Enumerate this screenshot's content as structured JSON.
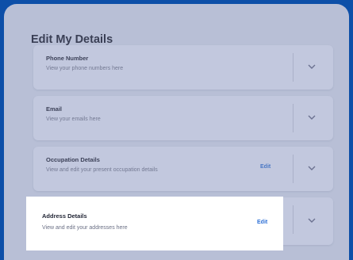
{
  "page": {
    "title": "Edit My Details"
  },
  "sections": [
    {
      "title": "Phone Number",
      "description": "View your phone numbers here",
      "action": ""
    },
    {
      "title": "Email",
      "description": "View your emails here",
      "action": ""
    },
    {
      "title": "Occupation Details",
      "description": "View and edit your present occupation details",
      "action": "Edit"
    },
    {
      "title": "Address Details",
      "description": "View and edit your addresses here",
      "action": "Edit"
    }
  ],
  "icons": {
    "expand": "chevron-down-icon"
  },
  "colors": {
    "outer_frame": "#0d4fa8",
    "overlay_background": "#b8bfd6",
    "highlight_background": "#ffffff",
    "edit_link": "#2c6fd6"
  }
}
